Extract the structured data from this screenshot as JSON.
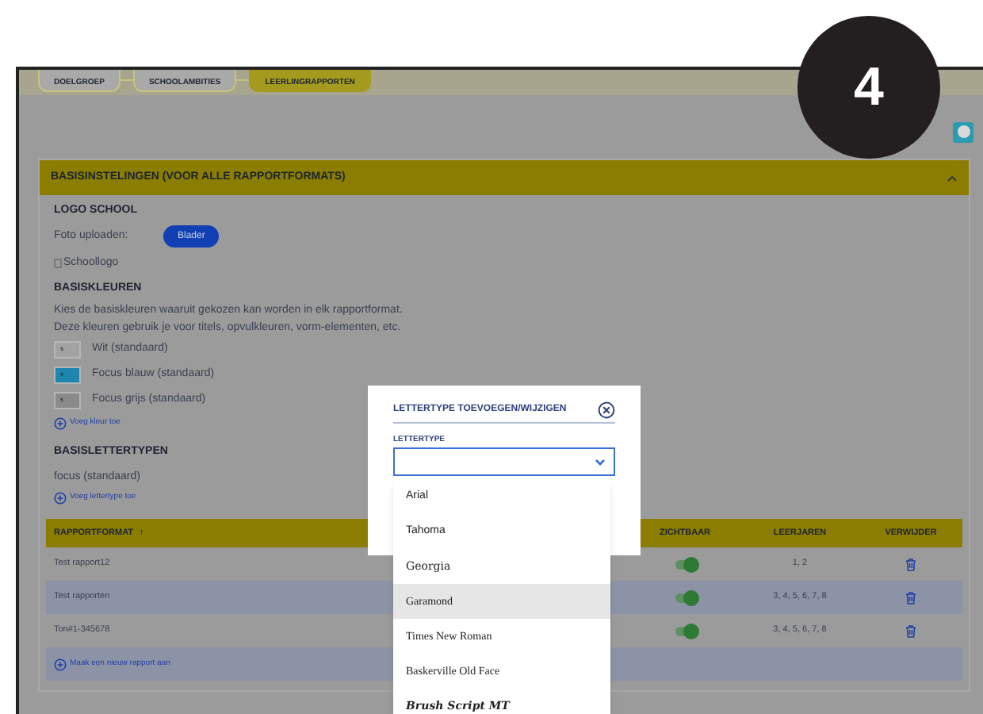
{
  "step_badge": "4",
  "steps": [
    {
      "label": "DOELGROEP",
      "selected": false
    },
    {
      "label": "SCHOOLAMBITIES",
      "selected": false
    },
    {
      "label": "LEERLINGRAPPORTEN",
      "selected": true
    }
  ],
  "panel": {
    "title": "BASISINSTELINGEN (VOOR ALLE RAPPORTFORMATS)",
    "expanded": true
  },
  "logo": {
    "heading": "LOGO SCHOOL",
    "upload_label": "Foto uploaden:",
    "browse_button": "Blader",
    "image_alt": "Schoollogo"
  },
  "colors": {
    "heading": "BASISKLEUREN",
    "description": [
      "Kies de basiskleuren waaruit gekozen kan worden in elk rapportformat.",
      "Deze kleuren gebruik je voor titels, opvulkleuren, vorm-elementen, etc."
    ],
    "items": [
      {
        "swatch": "s",
        "label": "Wit (standaard)",
        "color": "#a3a3a3"
      },
      {
        "swatch": "s",
        "label": "Focus blauw (standaard)",
        "color": "#1f86b0"
      },
      {
        "swatch": "s",
        "label": "Focus grijs (standaard)",
        "color": "#8a8a8a"
      }
    ],
    "add_link": "Voeg kleur toe"
  },
  "fonts": {
    "heading": "BASISLETTERTYPEN",
    "items": [
      "focus (standaard)"
    ],
    "add_link": "Voeg lettertype toe"
  },
  "table": {
    "columns": [
      "RAPPORTFORMAT",
      "ZICHTBAAR",
      "LEERJAREN",
      "VERWIJDER"
    ],
    "sort_indicator": "↑",
    "rows": [
      {
        "name": "Test rapport12",
        "on": true,
        "years": "1, 2"
      },
      {
        "name": "Test rapporten",
        "on": true,
        "years": "3, 4, 5, 6, 7, 8"
      },
      {
        "name": "Ton#1-345678",
        "on": true,
        "years": "3, 4, 5, 6, 7, 8"
      }
    ],
    "add_link": "Maak een nieuw rapport aan"
  },
  "dialog": {
    "title": "LETTERTYPE TOEVOEGEN/WIJZIGEN",
    "field_label": "LETTERTYPE",
    "expanded": true,
    "options": [
      {
        "label": "Arial",
        "selected": false
      },
      {
        "label": "Tahoma",
        "selected": false
      },
      {
        "label": "Georgia",
        "selected": false
      },
      {
        "label": "Garamond",
        "selected": true
      },
      {
        "label": "Times New Roman",
        "selected": false
      },
      {
        "label": "Baskerville Old Face",
        "selected": false
      },
      {
        "label": "Brush Script MT",
        "selected": false
      }
    ]
  }
}
